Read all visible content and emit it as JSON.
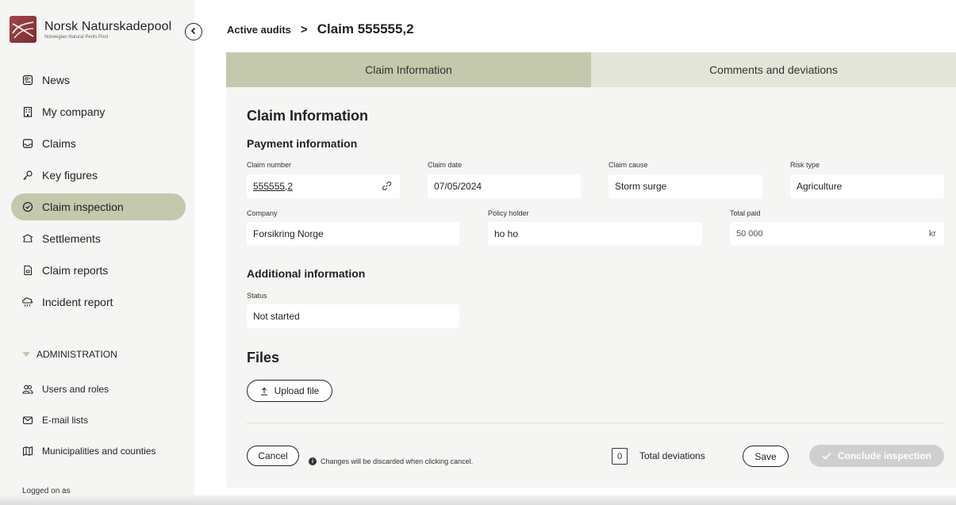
{
  "brand": {
    "name": "Norsk Naturskadepool",
    "subtitle": "Norwegian Natural Perils Pool"
  },
  "sidebar": {
    "items": [
      {
        "label": "News",
        "icon": "newspaper-icon",
        "active": false
      },
      {
        "label": "My company",
        "icon": "building-icon",
        "active": false
      },
      {
        "label": "Claims",
        "icon": "inbox-icon",
        "active": false
      },
      {
        "label": "Key figures",
        "icon": "key-icon",
        "active": false
      },
      {
        "label": "Claim inspection",
        "icon": "check-circle-icon",
        "active": true
      },
      {
        "label": "Settlements",
        "icon": "tent-icon",
        "active": false
      },
      {
        "label": "Claim reports",
        "icon": "report-icon",
        "active": false
      },
      {
        "label": "Incident report",
        "icon": "cloud-rain-icon",
        "active": false
      }
    ],
    "admin_header": "ADMINISTRATION",
    "admin_items": [
      {
        "label": "Users and roles",
        "icon": "users-icon"
      },
      {
        "label": "E-mail lists",
        "icon": "mail-icon"
      },
      {
        "label": "Municipalities and counties",
        "icon": "map-icon"
      }
    ],
    "logged_on_label": "Logged on as"
  },
  "breadcrumb": {
    "parent": "Active audits",
    "separator": ">",
    "current": "Claim 555555,2"
  },
  "tabs": [
    {
      "label": "Claim Information",
      "active": true
    },
    {
      "label": "Comments and deviations",
      "active": false
    }
  ],
  "claim_info": {
    "title": "Claim Information",
    "payment_title": "Payment information",
    "fields": {
      "claim_number": {
        "label": "Claim number",
        "value": "555555,2"
      },
      "claim_date": {
        "label": "Claim date",
        "value": "07/05/2024"
      },
      "claim_cause": {
        "label": "Claim cause",
        "value": "Storm surge"
      },
      "risk_type": {
        "label": "Risk type",
        "value": "Agriculture"
      },
      "company": {
        "label": "Company",
        "value": "Forsikring Norge"
      },
      "policy_holder": {
        "label": "Policy holder",
        "value": "ho ho"
      },
      "total_paid": {
        "label": "Total paid",
        "value": "50 000",
        "suffix": "kr"
      }
    },
    "additional_title": "Additional information",
    "status": {
      "label": "Status",
      "value": "Not started"
    }
  },
  "files": {
    "title": "Files",
    "upload_label": "Upload file"
  },
  "footer": {
    "cancel_label": "Cancel",
    "cancel_note": "Changes will be discarded when clicking cancel.",
    "deviation_count": "0",
    "deviations_label": "Total deviations",
    "save_label": "Save",
    "conclude_label": "Conclude inspection"
  },
  "colors": {
    "accent": "#c4c8ac",
    "tab_inactive": "#e3e5d9",
    "panel": "#f5f5f3",
    "brand": "#8e3439",
    "disabled": "#cfcfcf"
  }
}
